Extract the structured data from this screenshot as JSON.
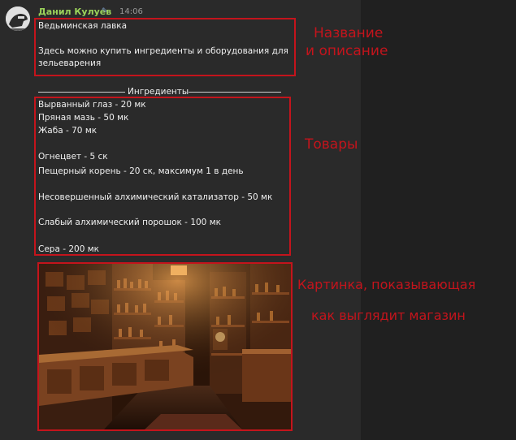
{
  "message": {
    "author": "Данил Кулуев",
    "time": "14:06",
    "title": "Ведьминская лавка",
    "description_line1": "Здесь можно купить ингредиенты и оборудования для",
    "description_line2": "зельеварения",
    "section_heading": "Ингредиенты",
    "items": [
      "Вырванный глаз - 20 мк",
      "Пряная мазь - 50 мк",
      "Жаба - 70 мк",
      "Огнецвет - 5 ск",
      "Пещерный корень - 20 ск, максимум 1 в день",
      "Несовершенный алхимический катализатор - 50 мк",
      "Слабый алхимический порошок - 100 мк",
      "Сера - 200 мк"
    ]
  },
  "annotations": {
    "name_line1": "Название",
    "name_line2": "и описание",
    "goods": "Товары",
    "picture_line1": "Картинка, показывающая",
    "picture_line2": "как выглядит магазин"
  },
  "colors": {
    "highlight_box": "#c4141c",
    "author_name": "#9bd25a"
  },
  "icons": {
    "avatar": "user-avatar",
    "verified": "pencil-icon"
  }
}
